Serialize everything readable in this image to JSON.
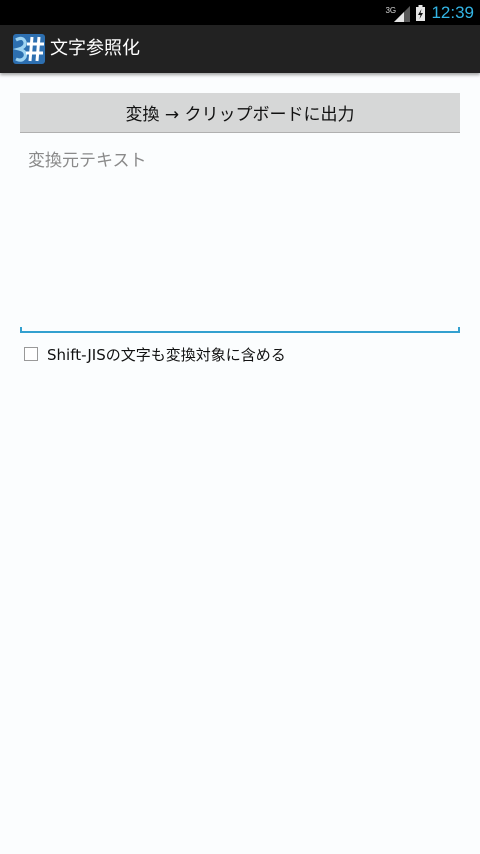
{
  "status_bar": {
    "network": "3G",
    "time": "12:39",
    "clock_color": "#33b5e5",
    "icons": [
      "signal-icon",
      "battery-charging-icon"
    ]
  },
  "action_bar": {
    "title": "文字参照化",
    "icon": "app-logo-icon",
    "background": "#222222"
  },
  "main": {
    "convert_button_label": "変換 → クリップボードに出力",
    "source_placeholder": "変換元テキスト",
    "source_value": "",
    "accent_color": "#33a0cf",
    "include_sjis_label": "Shift-JISの文字も変換対象に含める",
    "include_sjis_checked": false
  }
}
